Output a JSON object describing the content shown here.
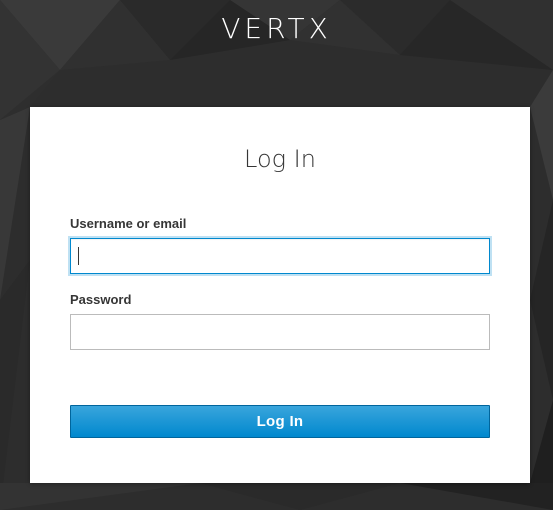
{
  "header": {
    "brand": "VERTX"
  },
  "login_form": {
    "title": "Log In",
    "username": {
      "label": "Username or email",
      "value": "",
      "placeholder": ""
    },
    "password": {
      "label": "Password",
      "value": "",
      "placeholder": ""
    },
    "submit_label": "Log In"
  },
  "colors": {
    "background": "#2c2c2c",
    "card": "#ffffff",
    "accent": "#0088ce",
    "text": "#363636"
  }
}
